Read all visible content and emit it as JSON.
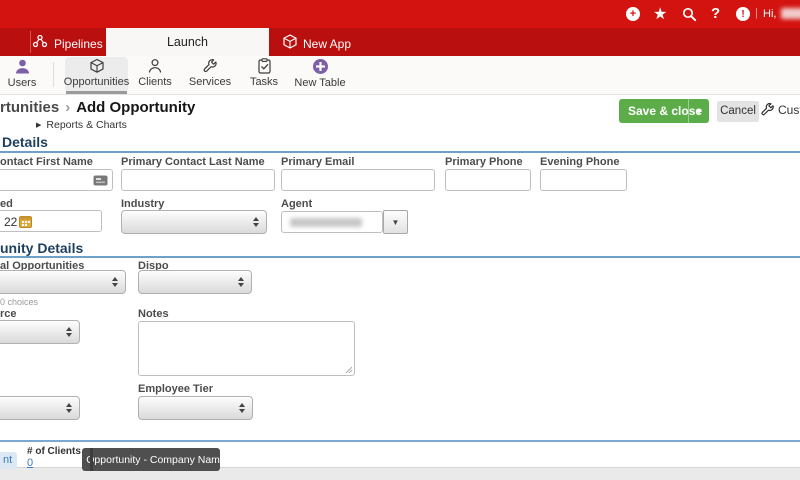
{
  "topbar": {
    "greeting": "Hi,",
    "plus_glyph": "+",
    "star_glyph": "★",
    "help_glyph": "?",
    "alert_glyph": "!",
    "divider_glyph": "|"
  },
  "tabs": {
    "pipelines": "Pipelines",
    "launch": "Launch",
    "new_app": "New App"
  },
  "tables": {
    "items": [
      {
        "label": "Users"
      },
      {
        "label": "Opportunities"
      },
      {
        "label": "Clients"
      },
      {
        "label": "Services"
      },
      {
        "label": "Tasks"
      },
      {
        "label": "New Table"
      }
    ]
  },
  "header": {
    "breadcrumb_parent": "rtunities",
    "breadcrumb_sep": "›",
    "title": "Add Opportunity",
    "reports_arrow": "▶",
    "reports_link": "Reports & Charts",
    "save_label": "Save & close",
    "save_caret": "▾",
    "cancel_label": "Cancel",
    "customize_label": "Custo"
  },
  "sections": {
    "contact_title": "Details",
    "opportunity_title": "unity Details"
  },
  "fields": {
    "first_name": {
      "label": "ontact First Name",
      "value": ""
    },
    "last_name": {
      "label": "Primary Contact Last Name",
      "value": ""
    },
    "email": {
      "label": "Primary Email",
      "value": ""
    },
    "phone": {
      "label": "Primary Phone",
      "value": ""
    },
    "evening_phone": {
      "label": "Evening Phone",
      "value": ""
    },
    "date_created": {
      "label": "ed",
      "value": "22"
    },
    "industry": {
      "label": "Industry",
      "value": ""
    },
    "agent": {
      "label": "Agent",
      "dropdown_glyph": "▼"
    },
    "additional_opportunities": {
      "label": "al Opportunities",
      "helper": "0 choices",
      "value": ""
    },
    "dispo": {
      "label": "Dispo",
      "value": ""
    },
    "source": {
      "label": "rce",
      "value": ""
    },
    "notes": {
      "label": "Notes",
      "value": ""
    },
    "employee_tier": {
      "label": "Employee Tier",
      "value": ""
    }
  },
  "footer": {
    "client_link": "nt",
    "clients_label": "# of Clients",
    "clients_count": "0",
    "tooltip": "Opportunity - Company Name"
  },
  "colors": {
    "top_red": "#d31310",
    "tab_red": "#b90f0e",
    "purple": "#7d5fa9",
    "green": "#5cad4a",
    "section_blue": "#6fa0ca",
    "link_blue": "#3a79bd",
    "tooltip_bg": "#4f4f4f"
  }
}
